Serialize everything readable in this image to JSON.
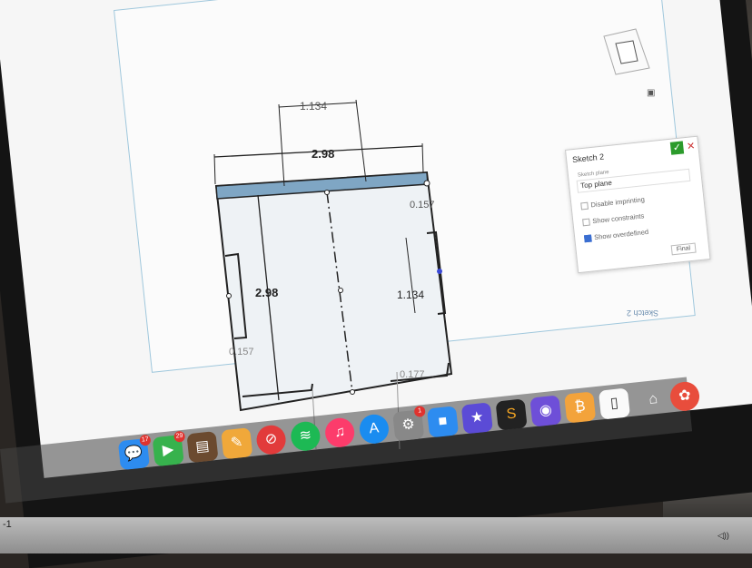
{
  "dimensions": {
    "top_small": "1.134",
    "top_width": "2.98",
    "left_height": "2.98",
    "right_small": "1.134",
    "right_thin": "0.157",
    "left_thin": "0.157",
    "bottom_thin": "0.177"
  },
  "panel": {
    "title": "Sketch 2",
    "plane_label": "Sketch plane",
    "plane_value": "Top plane",
    "option1": "Disable imprinting",
    "option2": "Show constraints",
    "option3": "Show overdefined",
    "final_button": "Final"
  },
  "sketch_label": "Sketch 2",
  "dock": {
    "badge_messages": "17",
    "badge_facetime": "29",
    "badge_settings": "1"
  },
  "corner_text": "-1",
  "key_label": "◁))"
}
